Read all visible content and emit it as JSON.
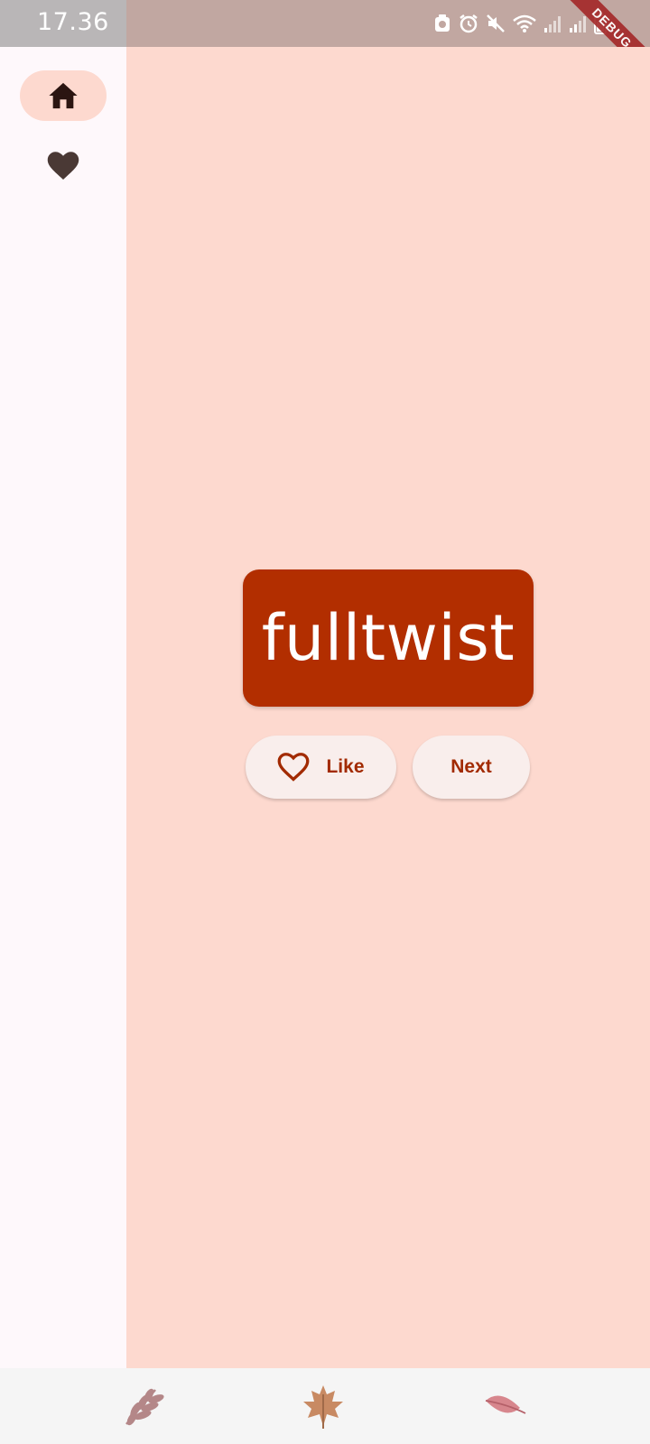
{
  "status_bar": {
    "time": "17.36",
    "icons": [
      "cast-icon",
      "alarm-icon",
      "mute-icon",
      "wifi-icon",
      "signal-icon",
      "signal-icon-2",
      "battery-icon"
    ],
    "debug_label": "DEBUG"
  },
  "rail": {
    "items": [
      {
        "name": "home",
        "icon": "home-icon",
        "active": true
      },
      {
        "name": "favorites",
        "icon": "heart-icon",
        "active": false
      }
    ]
  },
  "main": {
    "word": "fulltwist",
    "like_label": "Like",
    "next_label": "Next"
  },
  "bottom_bar": {
    "icons": [
      "fern-leaf-icon",
      "maple-leaf-icon",
      "pink-leaf-icon"
    ]
  },
  "colors": {
    "content_bg": "#fdd9cf",
    "card": "#b22e00",
    "accent_text": "#a22a00",
    "rail_bg": "#fef8fb"
  }
}
